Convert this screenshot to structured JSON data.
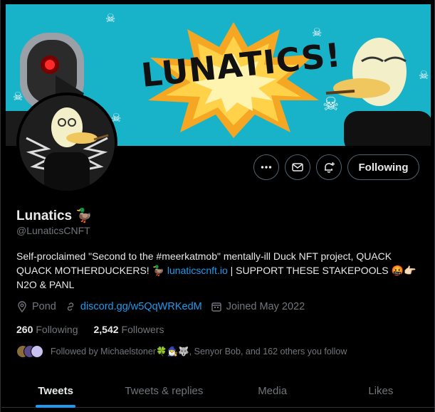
{
  "banner": {
    "title": "LUNATICS!",
    "bg_color": "#19b3c9"
  },
  "profile": {
    "name": "Lunatics 🦆",
    "handle": "@LunaticsCNFT",
    "bio_part1": "Self-proclaimed \"Second to the #meerkatmob\" mentally-ill Duck NFT project, QUACK QUACK MOTHERDUCKERS! 🦆 ",
    "bio_link": "lunaticscnft.io",
    "bio_part2": " | SUPPORT THESE STAKEPOOLS 🤬👉🏻 N2O & PANL",
    "location": "Pond",
    "website": "discord.gg/w5QqWRKedM",
    "joined": "Joined May 2022"
  },
  "actions": {
    "more_icon": "more-icon",
    "message_icon": "message-icon",
    "notify_icon": "notify-icon",
    "follow_label": "Following"
  },
  "stats": {
    "following_count": "260",
    "following_label": "Following",
    "followers_count": "2,542",
    "followers_label": "Followers"
  },
  "followed_by": "Followed by Michaelstoner🍀🧙‍♂️🐺, Senyor Bob, and 162 others you follow",
  "tabs": [
    {
      "label": "Tweets",
      "active": true
    },
    {
      "label": "Tweets & replies",
      "active": false
    },
    {
      "label": "Media",
      "active": false
    },
    {
      "label": "Likes",
      "active": false
    }
  ],
  "colors": {
    "accent": "#1d9bf0",
    "muted": "#71767b",
    "text": "#e7e9ea"
  }
}
